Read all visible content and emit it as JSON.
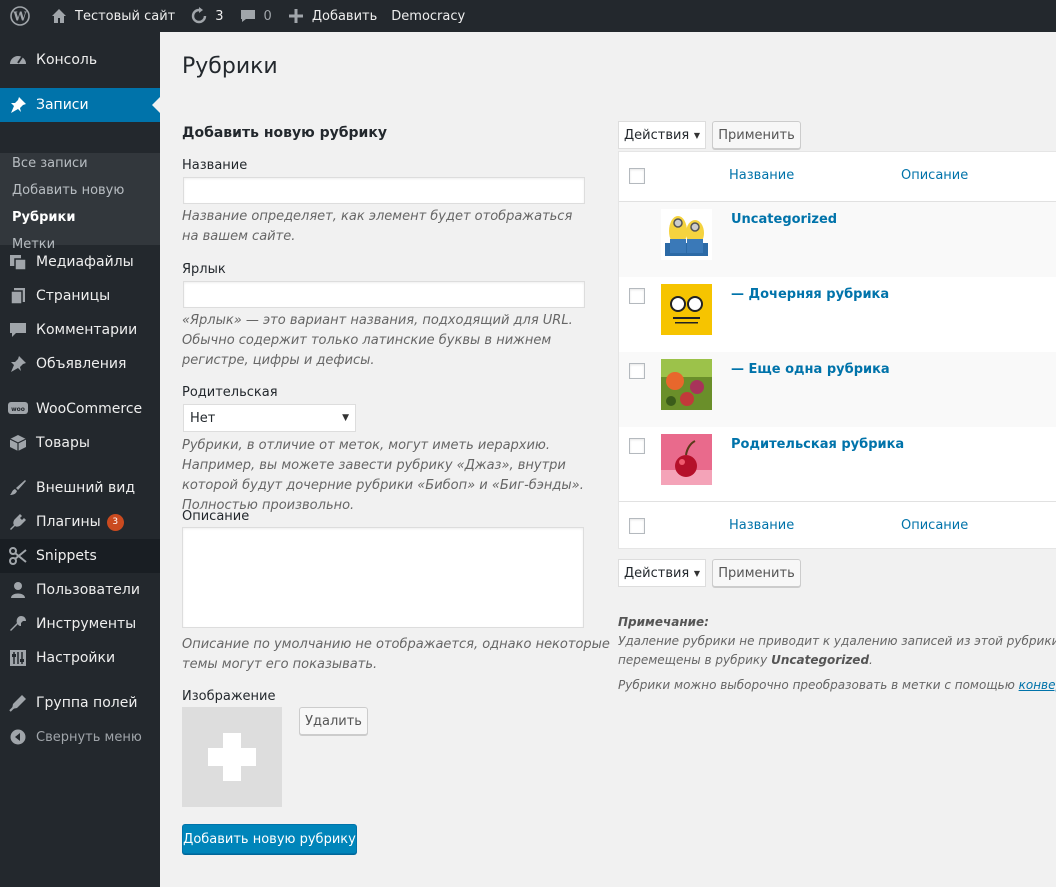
{
  "adminbar": {
    "site_name": "Тестовый сайт",
    "updates_count": "3",
    "comments_count": "0",
    "add_new": "Добавить",
    "democracy": "Democracy"
  },
  "sidebar": {
    "items": [
      {
        "label": "Консоль",
        "icon": "dashboard-icon"
      },
      {
        "label": "Записи",
        "icon": "pin-icon"
      },
      {
        "label": "Медиафайлы",
        "icon": "media-icon"
      },
      {
        "label": "Страницы",
        "icon": "pages-icon"
      },
      {
        "label": "Комментарии",
        "icon": "comments-icon"
      },
      {
        "label": "Объявления",
        "icon": "pin-icon"
      },
      {
        "label": "WooCommerce",
        "icon": "woo-icon"
      },
      {
        "label": "Товары",
        "icon": "box-icon"
      },
      {
        "label": "Внешний вид",
        "icon": "brush-icon"
      },
      {
        "label": "Плагины",
        "icon": "plugin-icon",
        "badge": "3"
      },
      {
        "label": "Snippets",
        "icon": "scissors-icon"
      },
      {
        "label": "Пользователи",
        "icon": "users-icon"
      },
      {
        "label": "Инструменты",
        "icon": "wrench-icon"
      },
      {
        "label": "Настройки",
        "icon": "settings-icon"
      },
      {
        "label": "Группа полей",
        "icon": "acf-icon"
      },
      {
        "label": "Свернуть меню",
        "icon": "collapse-icon"
      }
    ],
    "submenu": [
      "Все записи",
      "Добавить новую",
      "Рубрики",
      "Метки"
    ]
  },
  "page": {
    "title": "Рубрики",
    "form_title": "Добавить новую рубрику",
    "name_label": "Название",
    "name_desc": "Название определяет, как элемент будет отображаться на вашем сайте.",
    "slug_label": "Ярлык",
    "slug_desc": "«Ярлык» — это вариант названия, подходящий для URL. Обычно содержит только латинские буквы в нижнем регистре, цифры и дефисы.",
    "parent_label": "Родительская",
    "parent_value": "Нет",
    "parent_desc": "Рубрики, в отличие от меток, могут иметь иерархию. Например, вы можете завести рубрику «Джаз», внутри которой будут дочерние рубрики «Бибоп» и «Биг-бэнды». Полностью произвольно.",
    "description_label": "Описание",
    "description_desc": "Описание по умолчанию не отображается, однако некоторые темы могут его показывать.",
    "image_label": "Изображение",
    "remove_button": "Удалить",
    "submit_button": "Добавить новую рубрику"
  },
  "list": {
    "bulk_actions": "Действия",
    "apply": "Применить",
    "col_name": "Название",
    "col_description": "Описание",
    "rows": [
      {
        "name": "Uncategorized",
        "has_checkbox": false
      },
      {
        "name": "— Дочерняя рубрика",
        "has_checkbox": true
      },
      {
        "name": "— Еще одна рубрика",
        "has_checkbox": true
      },
      {
        "name": "Родительская рубрика",
        "has_checkbox": true
      }
    ],
    "note_title": "Примечание:",
    "note_line1": "Удаление рубрики не приводит к удалению записей из этой рубрики. Вме",
    "note_line2_prefix": "перемещены в рубрику ",
    "note_line2_bold": "Uncategorized",
    "note_line2_suffix": ".",
    "note_line3_prefix": "Рубрики можно выборочно преобразовать в метки с помощью ",
    "note_line3_link": "конверт"
  },
  "colors": {
    "accent": "#0073aa",
    "sidebar_bg": "#23282d",
    "primary_button": "#0085ba",
    "badge": "#ca4a1f"
  }
}
